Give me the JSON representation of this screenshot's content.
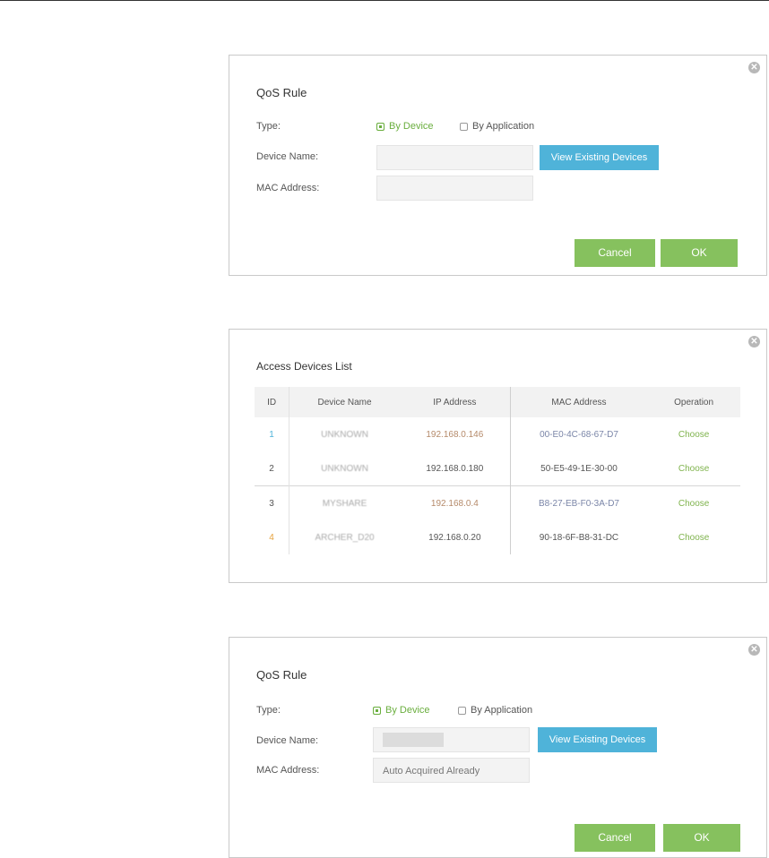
{
  "qos_rule_before": {
    "title": "QoS Rule",
    "type_label": "Type:",
    "type_options": [
      "By Device",
      "By Application"
    ],
    "selected_type": "By Device",
    "device_name_label": "Device Name:",
    "device_name_value": "",
    "mac_label": "MAC Address:",
    "mac_value": "",
    "view_button": "View Existing Devices",
    "cancel_button": "Cancel",
    "ok_button": "OK"
  },
  "access_devices": {
    "title": "Access Devices List",
    "columns": [
      "ID",
      "Device Name",
      "IP Address",
      "MAC Address",
      "Operation"
    ],
    "rows": [
      {
        "id": "1",
        "name": "UNKNOWN",
        "ip": "192.168.0.146",
        "mac": "00-E0-4C-68-67-D7",
        "op": "Choose"
      },
      {
        "id": "2",
        "name": "UNKNOWN",
        "ip": "192.168.0.180",
        "mac": "50-E5-49-1E-30-00",
        "op": "Choose"
      },
      {
        "id": "3",
        "name": "MYSHARE",
        "ip": "192.168.0.4",
        "mac": "B8-27-EB-F0-3A-D7",
        "op": "Choose"
      },
      {
        "id": "4",
        "name": "ARCHER_D20",
        "ip": "192.168.0.20",
        "mac": "90-18-6F-B8-31-DC",
        "op": "Choose"
      }
    ]
  },
  "qos_rule_after": {
    "title": "QoS Rule",
    "type_label": "Type:",
    "type_options": [
      "By Device",
      "By Application"
    ],
    "selected_type": "By Device",
    "device_name_label": "Device Name:",
    "device_name_value": "",
    "mac_label": "MAC Address:",
    "mac_value": "Auto Acquired Already",
    "view_button": "View Existing Devices",
    "cancel_button": "Cancel",
    "ok_button": "OK"
  },
  "colors": {
    "accent_green": "#86c15e",
    "accent_blue": "#4fb3d9"
  }
}
